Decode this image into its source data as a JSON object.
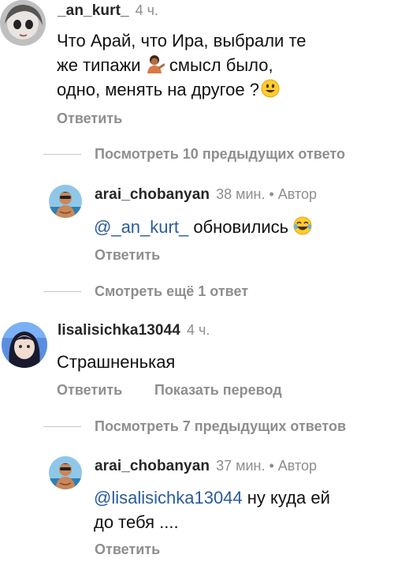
{
  "comments": [
    {
      "username": "_an_kurt_",
      "time": "4 ч.",
      "text_lines": [
        "Что Арай, что Ира, выбрали те",
        "же типажи",
        "смысл было,",
        "одно, менять на другое ?"
      ],
      "reply_label": "Ответить"
    },
    {
      "username": "lisalisichka13044",
      "time": "4 ч.",
      "text": "Страшненькая",
      "reply_label": "Ответить",
      "translate_label": "Показать перевод"
    }
  ],
  "thread1": {
    "view_previous": "Посмотреть 10 предыдущих ответо",
    "reply": {
      "username": "arai_chobanyan",
      "meta": "38 мин. • Автор",
      "mention": "@_an_kurt_",
      "text": "обновились",
      "reply_label": "Ответить"
    },
    "view_more": "Смотреть ещё 1 ответ"
  },
  "thread2": {
    "view_previous": "Посмотреть 7 предыдущих ответов",
    "reply": {
      "username": "arai_chobanyan",
      "meta": "37 мин. • Автор",
      "mention": "@lisalisichka13044",
      "text_line1": "ну куда ей",
      "text_line2": "до тебя ....",
      "reply_label": "Ответить"
    }
  },
  "icons": {
    "emoji_person": "person-tipping-hand-emoji",
    "emoji_smile": "smiling-face-emoji",
    "emoji_laugh": "tears-of-joy-emoji"
  }
}
